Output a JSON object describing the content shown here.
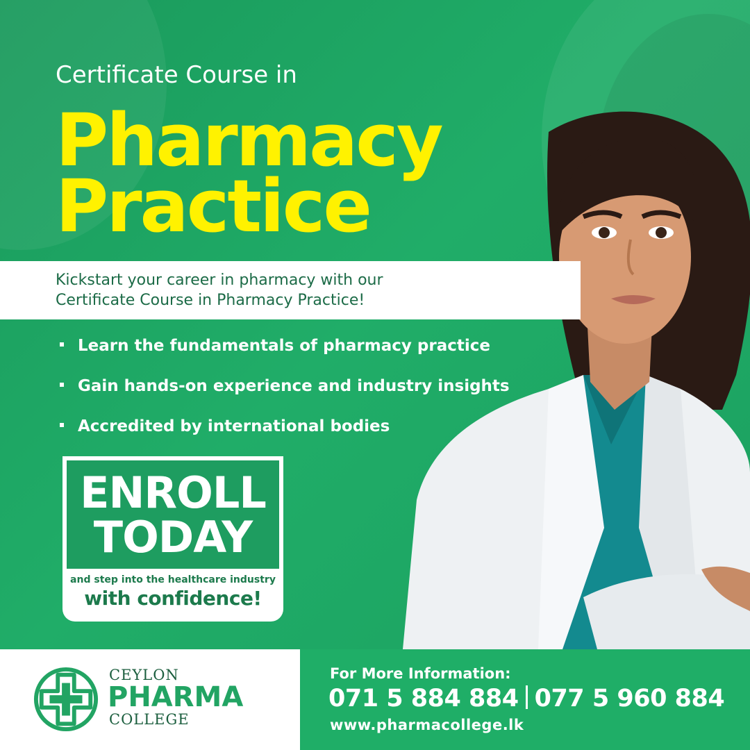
{
  "header": {
    "pretitle": "Certificate Course in",
    "title_line1": "Pharmacy",
    "title_line2": "Practice"
  },
  "intro": {
    "line1": "Kickstart your career in pharmacy with our",
    "line2": "Certificate Course in Pharmacy Practice!"
  },
  "bullets": [
    "Learn the fundamentals of pharmacy practice",
    "Gain hands-on experience and industry insights",
    "Accredited by international bodies"
  ],
  "cta": {
    "line1": "ENROLL",
    "line2": "TODAY",
    "sub_small": "and step into the healthcare industry",
    "sub_big": "with confidence!"
  },
  "logo": {
    "line1": "CEYLON",
    "line2": "PHARMA",
    "line3": "COLLEGE"
  },
  "contact": {
    "label": "For More Information:",
    "phone1": "071 5 884 884",
    "phone2": "077 5 960 884",
    "website": "www.pharmacollege.lk"
  },
  "colors": {
    "green": "#1fae67",
    "yellow": "#fff200",
    "dark_green": "#1b5e3e"
  }
}
